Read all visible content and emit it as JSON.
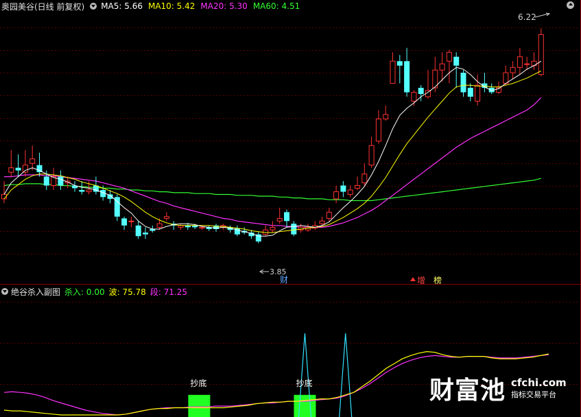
{
  "main_header": {
    "title": "奥园美谷(日线 前复权)",
    "ma_items": [
      {
        "label": "MA5: 5.66",
        "color": "#ffffff"
      },
      {
        "label": "MA10: 5.42",
        "color": "#ffff00"
      },
      {
        "label": "MA20: 5.30",
        "color": "#ff33ff"
      },
      {
        "label": "MA60: 4.51",
        "color": "#33ff33"
      }
    ]
  },
  "sub_header": {
    "title": "绝谷杀入副图",
    "items": [
      {
        "label": "杀入: 0.00",
        "color": "#33ff33"
      },
      {
        "label": "波: 75.78",
        "color": "#ffff00"
      },
      {
        "label": "段: 71.25",
        "color": "#ff33ff"
      }
    ]
  },
  "chart_data": [
    {
      "type": "candlestick",
      "title": "奥园美谷(日线 前复权)",
      "colors": {
        "up": "#ff3232",
        "down": "#54ffff",
        "ma5": "#ffffff",
        "ma10": "#ffff00",
        "ma20": "#ff33ff",
        "ma60": "#33ff33"
      },
      "ylim": [
        3.45,
        6.4
      ],
      "annotations": {
        "high_label": "6.22",
        "low_label": "3.85"
      },
      "candles": [
        [
          4.3,
          4.35,
          4.5,
          4.25
        ],
        [
          4.6,
          4.65,
          4.85,
          4.55
        ],
        [
          4.65,
          4.62,
          4.8,
          4.55
        ],
        [
          4.6,
          4.68,
          4.85,
          4.55
        ],
        [
          4.7,
          4.75,
          4.9,
          4.62
        ],
        [
          4.68,
          4.6,
          4.82,
          4.55
        ],
        [
          4.55,
          4.45,
          4.62,
          4.4
        ],
        [
          4.45,
          4.55,
          4.65,
          4.4
        ],
        [
          4.55,
          4.45,
          4.62,
          4.4
        ],
        [
          4.48,
          4.5,
          4.55,
          4.42
        ],
        [
          4.45,
          4.42,
          4.5,
          4.38
        ],
        [
          4.4,
          4.38,
          4.5,
          4.35
        ],
        [
          4.38,
          4.4,
          4.5,
          4.35
        ],
        [
          4.45,
          4.38,
          4.55,
          4.35
        ],
        [
          4.4,
          4.32,
          4.45,
          4.28
        ],
        [
          4.35,
          4.3,
          4.4,
          4.25
        ],
        [
          4.32,
          4.1,
          4.35,
          4.05
        ],
        [
          4.08,
          4.0,
          4.1,
          3.95
        ],
        [
          4.05,
          4.05,
          4.1,
          3.98
        ],
        [
          4.0,
          3.88,
          4.05,
          3.85
        ],
        [
          3.92,
          3.9,
          3.98,
          3.85
        ],
        [
          3.96,
          3.94,
          4.0,
          3.92
        ],
        [
          3.98,
          4.02,
          4.08,
          3.95
        ],
        [
          4.08,
          4.1,
          4.15,
          4.05
        ],
        [
          4.02,
          4.0,
          4.05,
          3.95
        ],
        [
          3.98,
          4.0,
          4.02,
          3.95
        ],
        [
          4.0,
          3.98,
          4.03,
          3.95
        ],
        [
          4.0,
          3.98,
          4.02,
          3.96
        ],
        [
          3.97,
          3.98,
          4.0,
          3.95
        ],
        [
          3.98,
          3.96,
          4.0,
          3.94
        ],
        [
          4.0,
          3.96,
          4.02,
          3.93
        ],
        [
          3.98,
          4.0,
          4.02,
          3.95
        ],
        [
          3.98,
          3.95,
          4.0,
          3.92
        ],
        [
          3.97,
          3.9,
          4.0,
          3.88
        ],
        [
          3.94,
          3.92,
          3.98,
          3.9
        ],
        [
          3.92,
          3.88,
          3.95,
          3.85
        ],
        [
          3.9,
          3.82,
          3.93,
          3.8
        ],
        [
          3.9,
          3.95,
          4.0,
          3.88
        ],
        [
          3.95,
          3.98,
          4.05,
          3.92
        ],
        [
          4.05,
          4.08,
          4.2,
          4.02
        ],
        [
          4.15,
          4.05,
          4.18,
          3.98
        ],
        [
          4.02,
          3.9,
          4.05,
          3.88
        ],
        [
          3.95,
          3.98,
          4.02,
          3.92
        ],
        [
          3.95,
          3.98,
          4.02,
          3.93
        ],
        [
          3.97,
          4.0,
          4.05,
          3.95
        ],
        [
          4.02,
          4.05,
          4.1,
          4.0
        ],
        [
          4.08,
          4.15,
          4.2,
          4.05
        ],
        [
          4.3,
          4.38,
          4.45,
          4.25
        ],
        [
          4.45,
          4.38,
          4.5,
          4.32
        ],
        [
          4.35,
          4.4,
          4.45,
          4.32
        ],
        [
          4.42,
          4.45,
          4.55,
          4.4
        ],
        [
          4.48,
          4.58,
          4.7,
          4.45
        ],
        [
          4.68,
          4.9,
          5.0,
          4.65
        ],
        [
          4.95,
          5.2,
          5.3,
          4.92
        ],
        [
          5.2,
          5.25,
          5.35,
          5.18
        ],
        [
          5.6,
          5.85,
          5.95,
          5.6
        ],
        [
          5.85,
          5.8,
          5.92,
          5.6
        ],
        [
          5.85,
          5.5,
          6.0,
          5.45
        ],
        [
          5.4,
          5.5,
          5.52,
          5.35
        ],
        [
          5.55,
          5.48,
          5.58,
          5.4
        ],
        [
          5.45,
          5.52,
          5.75,
          5.43
        ],
        [
          5.55,
          5.75,
          5.9,
          5.5
        ],
        [
          5.75,
          5.82,
          5.95,
          5.62
        ],
        [
          5.85,
          5.95,
          5.98,
          5.6
        ],
        [
          5.9,
          5.8,
          5.95,
          5.55
        ],
        [
          5.72,
          5.5,
          5.75,
          5.45
        ],
        [
          5.55,
          5.45,
          5.6,
          5.4
        ],
        [
          5.4,
          5.58,
          5.7,
          5.35
        ],
        [
          5.6,
          5.55,
          5.72,
          5.5
        ],
        [
          5.55,
          5.5,
          5.6,
          5.48
        ],
        [
          5.5,
          5.55,
          5.62,
          5.48
        ],
        [
          5.6,
          5.72,
          5.8,
          5.58
        ],
        [
          5.72,
          5.78,
          5.85,
          5.65
        ],
        [
          5.78,
          5.9,
          6.0,
          5.7
        ],
        [
          5.82,
          5.82,
          5.9,
          5.75
        ],
        [
          5.8,
          5.85,
          5.95,
          5.75
        ],
        [
          5.7,
          6.15,
          6.22,
          5.68
        ]
      ],
      "ma5": [
        4.35,
        4.48,
        4.55,
        4.62,
        4.65,
        4.62,
        4.58,
        4.54,
        4.52,
        4.49,
        4.45,
        4.43,
        4.42,
        4.4,
        4.37,
        4.34,
        4.27,
        4.2,
        4.14,
        4.05,
        3.99,
        3.96,
        3.96,
        3.99,
        4.01,
        4.02,
        4.02,
        4.01,
        3.99,
        3.98,
        3.97,
        3.98,
        3.97,
        3.95,
        3.93,
        3.91,
        3.88,
        3.88,
        3.89,
        3.94,
        3.98,
        3.99,
        4.0,
        3.99,
        3.98,
        4.0,
        4.04,
        4.12,
        4.2,
        4.27,
        4.35,
        4.44,
        4.57,
        4.72,
        4.9,
        5.09,
        5.24,
        5.32,
        5.38,
        5.45,
        5.5,
        5.56,
        5.64,
        5.72,
        5.78,
        5.76,
        5.7,
        5.62,
        5.56,
        5.52,
        5.54,
        5.6,
        5.65,
        5.7,
        5.76,
        5.8,
        5.85
      ],
      "ma10": [
        4.3,
        4.4,
        4.46,
        4.52,
        4.56,
        4.58,
        4.58,
        4.57,
        4.56,
        4.54,
        4.52,
        4.49,
        4.47,
        4.45,
        4.42,
        4.39,
        4.36,
        4.32,
        4.27,
        4.21,
        4.15,
        4.1,
        4.06,
        4.03,
        4.01,
        4.0,
        4.0,
        4.0,
        4.0,
        4.0,
        3.99,
        3.99,
        3.98,
        3.97,
        3.96,
        3.94,
        3.93,
        3.92,
        3.92,
        3.93,
        3.94,
        3.95,
        3.96,
        3.97,
        3.98,
        3.99,
        4.01,
        4.05,
        4.09,
        4.14,
        4.19,
        4.25,
        4.33,
        4.43,
        4.54,
        4.67,
        4.8,
        4.92,
        5.02,
        5.12,
        5.22,
        5.31,
        5.4,
        5.49,
        5.56,
        5.58,
        5.58,
        5.57,
        5.57,
        5.56,
        5.56,
        5.58,
        5.6,
        5.63,
        5.66,
        5.7,
        5.74
      ],
      "ma20": [
        4.55,
        4.55,
        4.56,
        4.57,
        4.57,
        4.57,
        4.56,
        4.56,
        4.55,
        4.54,
        4.53,
        4.52,
        4.51,
        4.5,
        4.48,
        4.46,
        4.44,
        4.42,
        4.39,
        4.36,
        4.33,
        4.3,
        4.27,
        4.25,
        4.22,
        4.2,
        4.18,
        4.16,
        4.14,
        4.12,
        4.1,
        4.08,
        4.07,
        4.05,
        4.04,
        4.03,
        4.02,
        4.01,
        4.0,
        4.0,
        3.99,
        3.99,
        3.98,
        3.98,
        3.98,
        3.98,
        3.99,
        4.01,
        4.03,
        4.06,
        4.09,
        4.13,
        4.17,
        4.22,
        4.28,
        4.34,
        4.4,
        4.46,
        4.52,
        4.58,
        4.64,
        4.7,
        4.76,
        4.82,
        4.88,
        4.93,
        4.98,
        5.02,
        5.06,
        5.1,
        5.14,
        5.18,
        5.22,
        5.26,
        5.3,
        5.36,
        5.44
      ],
      "ma60": [
        4.45,
        4.46,
        4.46,
        4.47,
        4.47,
        4.47,
        4.46,
        4.46,
        4.45,
        4.45,
        4.44,
        4.44,
        4.43,
        4.43,
        4.42,
        4.42,
        4.41,
        4.41,
        4.4,
        4.4,
        4.39,
        4.39,
        4.38,
        4.38,
        4.37,
        4.37,
        4.37,
        4.36,
        4.36,
        4.36,
        4.35,
        4.35,
        4.35,
        4.34,
        4.34,
        4.34,
        4.33,
        4.33,
        4.33,
        4.32,
        4.32,
        4.31,
        4.31,
        4.3,
        4.3,
        4.3,
        4.29,
        4.29,
        4.29,
        4.28,
        4.28,
        4.28,
        4.28,
        4.29,
        4.3,
        4.31,
        4.32,
        4.33,
        4.34,
        4.35,
        4.36,
        4.37,
        4.38,
        4.39,
        4.4,
        4.41,
        4.42,
        4.43,
        4.44,
        4.45,
        4.46,
        4.47,
        4.48,
        4.49,
        4.5,
        4.51,
        4.53
      ]
    },
    {
      "type": "line",
      "title": "绝谷杀入副图",
      "ylim": [
        0,
        100
      ],
      "series": [
        {
          "name": "波",
          "color": "#ffff00",
          "values": [
            6,
            5,
            5,
            4,
            3,
            2,
            1,
            0,
            0,
            0,
            0,
            0,
            0,
            0,
            0,
            1,
            3,
            5,
            7,
            8,
            8,
            9,
            9,
            9,
            9,
            9,
            9,
            9,
            10,
            11,
            12,
            14,
            15,
            16,
            16,
            17,
            17,
            18,
            19,
            20,
            20,
            22,
            25,
            28,
            35,
            42,
            50,
            58,
            64,
            70,
            74,
            77,
            79,
            78,
            75,
            73,
            72,
            73,
            73,
            73,
            71,
            70,
            70,
            70,
            71,
            72,
            74,
            76
          ]
        },
        {
          "name": "段",
          "color": "#ff33ff",
          "values": [
            28,
            29,
            28,
            27,
            25,
            22,
            18,
            15,
            12,
            9,
            6,
            4,
            2,
            1,
            0,
            1,
            3,
            5,
            7,
            8,
            9,
            9,
            9,
            10,
            10,
            10,
            11,
            11,
            11,
            12,
            13,
            14,
            15,
            15,
            16,
            17,
            17,
            17,
            18,
            19,
            20,
            21,
            24,
            28,
            33,
            39,
            46,
            53,
            59,
            64,
            68,
            71,
            73,
            74,
            73,
            72,
            72,
            73,
            73,
            73,
            72,
            71,
            71,
            71,
            72,
            73,
            74,
            75
          ]
        },
        {
          "name": "杀入",
          "color": "#33ff33",
          "values": []
        }
      ],
      "spikes_color": "#33e0ff",
      "spikes": [
        {
          "index": 37,
          "value": 100
        },
        {
          "index": 42,
          "value": 100
        }
      ],
      "blocks": [
        {
          "index": 24,
          "label": "抄底",
          "value": 25
        },
        {
          "index": 37,
          "label": "抄底",
          "value": 25
        }
      ]
    }
  ],
  "markers": {
    "cai": "财",
    "zeng": "增",
    "bang": "榜"
  },
  "watermark": {
    "brand": "财富池",
    "site": "cfchi.com",
    "slogan": "指标交易平台"
  }
}
